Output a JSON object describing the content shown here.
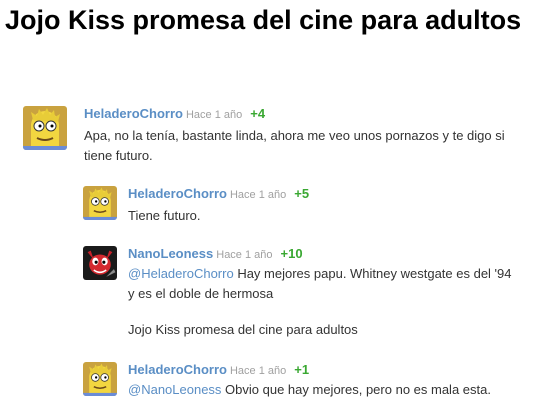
{
  "page": {
    "title": "Jojo Kiss promesa del cine para adultos"
  },
  "comments": [
    {
      "author": "HeladeroChorro",
      "time": "Hace 1 año",
      "score": "+4",
      "avatar": "simpsons-character-avatar",
      "text": "Apa, no la tenía, bastante linda, ahora me veo unos pornazos y te digo si tiene futuro."
    },
    {
      "author": "HeladeroChorro",
      "time": "Hace 1 año",
      "score": "+5",
      "avatar": "simpsons-character-avatar",
      "text": "Tiene futuro."
    },
    {
      "author": "NanoLeoness",
      "time": "Hace 1 año",
      "score": "+10",
      "avatar": "red-cartoon-character-avatar",
      "mention": "@HeladeroChorro",
      "text": " Hay mejores papu. Whitney westgate es del '94 y es el doble de hermosa",
      "text2": "Jojo Kiss promesa del cine para adultos"
    },
    {
      "author": "HeladeroChorro",
      "time": "Hace 1 año",
      "score": "+1",
      "avatar": "simpsons-character-avatar",
      "mention": "@NanoLeoness",
      "text": " Obvio que hay mejores, pero no es mala esta."
    }
  ],
  "colors": {
    "author": "#5a8ec5",
    "score": "#3aa832",
    "time": "#a0a0a0"
  }
}
